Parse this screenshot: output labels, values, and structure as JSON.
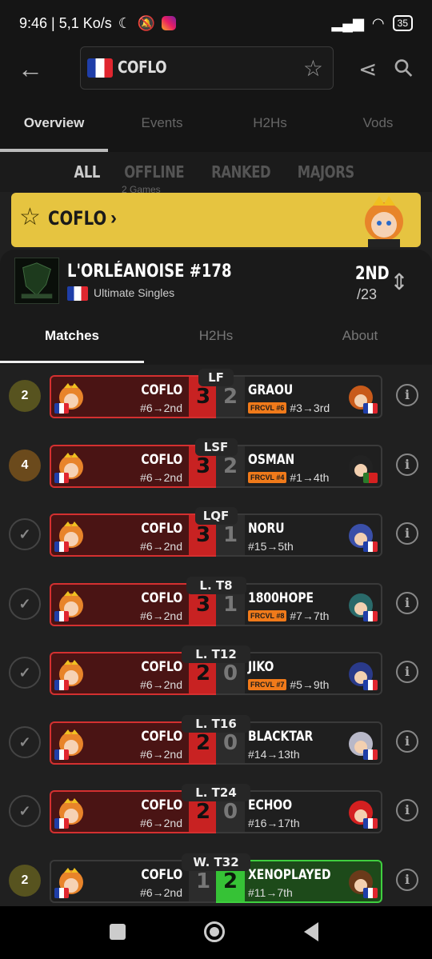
{
  "status_bar": {
    "time_speed": "9:46 | 5,1 Ko/s",
    "battery": "35"
  },
  "header": {
    "search_value": "COFLO"
  },
  "main_tabs": [
    {
      "label": "Overview"
    },
    {
      "label": "Events"
    },
    {
      "label": "H2Hs"
    },
    {
      "label": "Vods"
    }
  ],
  "filters": [
    {
      "label": "ALL"
    },
    {
      "label": "OFFLINE"
    },
    {
      "label": "RANKED"
    },
    {
      "label": "MAJORS"
    }
  ],
  "under_text": "2 Games",
  "banner": {
    "player": "COFLO",
    "arrow": "›"
  },
  "tournament": {
    "name": "L'ORLÉANOISE #178",
    "event": "Ultimate Singles",
    "placement": "2ND",
    "total": "/23"
  },
  "sub_tabs": [
    {
      "label": "Matches"
    },
    {
      "label": "H2Hs"
    },
    {
      "label": "About"
    }
  ],
  "matches": [
    {
      "round": "LF",
      "status": "2",
      "status_type": "olive",
      "p1": "COFLO",
      "p1_seed": "#6→2nd",
      "s1": "3",
      "s2": "2",
      "p2": "GRAOU",
      "p2_tag": "FRCVL #6",
      "p2_seed": "#3→3rd",
      "p1_won": true,
      "p2_char_color": "#c85a1a"
    },
    {
      "round": "LSF",
      "status": "4",
      "status_type": "brown",
      "p1": "COFLO",
      "p1_seed": "#6→2nd",
      "s1": "3",
      "s2": "2",
      "p2": "OSMAN",
      "p2_tag": "FRCVL #4",
      "p2_seed": "#1→4th",
      "p1_won": true,
      "p2_char_color": "#222222"
    },
    {
      "round": "LQF",
      "status": "✓",
      "status_type": "done",
      "p1": "COFLO",
      "p1_seed": "#6→2nd",
      "s1": "3",
      "s2": "1",
      "p2": "NORU",
      "p2_tag": "",
      "p2_seed": "#15→5th",
      "p1_won": true,
      "p2_char_color": "#3a4fa8"
    },
    {
      "round": "L. T8",
      "status": "✓",
      "status_type": "done",
      "p1": "COFLO",
      "p1_seed": "#6→2nd",
      "s1": "3",
      "s2": "1",
      "p2": "1800HOPE",
      "p2_tag": "FRCVL #8",
      "p2_seed": "#7→7th",
      "p1_won": true,
      "p2_char_color": "#2a6a6a"
    },
    {
      "round": "L. T12",
      "status": "✓",
      "status_type": "done",
      "p1": "COFLO",
      "p1_seed": "#6→2nd",
      "s1": "2",
      "s2": "0",
      "p2": "JIKO",
      "p2_tag": "FRCVL #7",
      "p2_seed": "#5→9th",
      "p1_won": true,
      "p2_char_color": "#2a3a8a"
    },
    {
      "round": "L. T16",
      "status": "✓",
      "status_type": "done",
      "p1": "COFLO",
      "p1_seed": "#6→2nd",
      "s1": "2",
      "s2": "0",
      "p2": "BLACKTAR",
      "p2_tag": "",
      "p2_seed": "#14→13th",
      "p1_won": true,
      "p2_char_color": "#b8b8c8"
    },
    {
      "round": "L. T24",
      "status": "✓",
      "status_type": "done",
      "p1": "COFLO",
      "p1_seed": "#6→2nd",
      "s1": "2",
      "s2": "0",
      "p2": "ECHOO",
      "p2_tag": "",
      "p2_seed": "#16→17th",
      "p1_won": true,
      "p2_char_color": "#d42020"
    },
    {
      "round": "W. T32",
      "status": "2",
      "status_type": "olive",
      "p1": "COFLO",
      "p1_seed": "#6→2nd",
      "s1": "1",
      "s2": "2",
      "p2": "XENOPLAYED",
      "p2_tag": "",
      "p2_seed": "#11→7th",
      "p1_won": false,
      "p2_char_color": "#6a3a1a"
    }
  ],
  "colors": {
    "banner": "#e6c440",
    "win_red": "#c82222",
    "win_green": "#36c236",
    "tag": "#f07a1a"
  }
}
